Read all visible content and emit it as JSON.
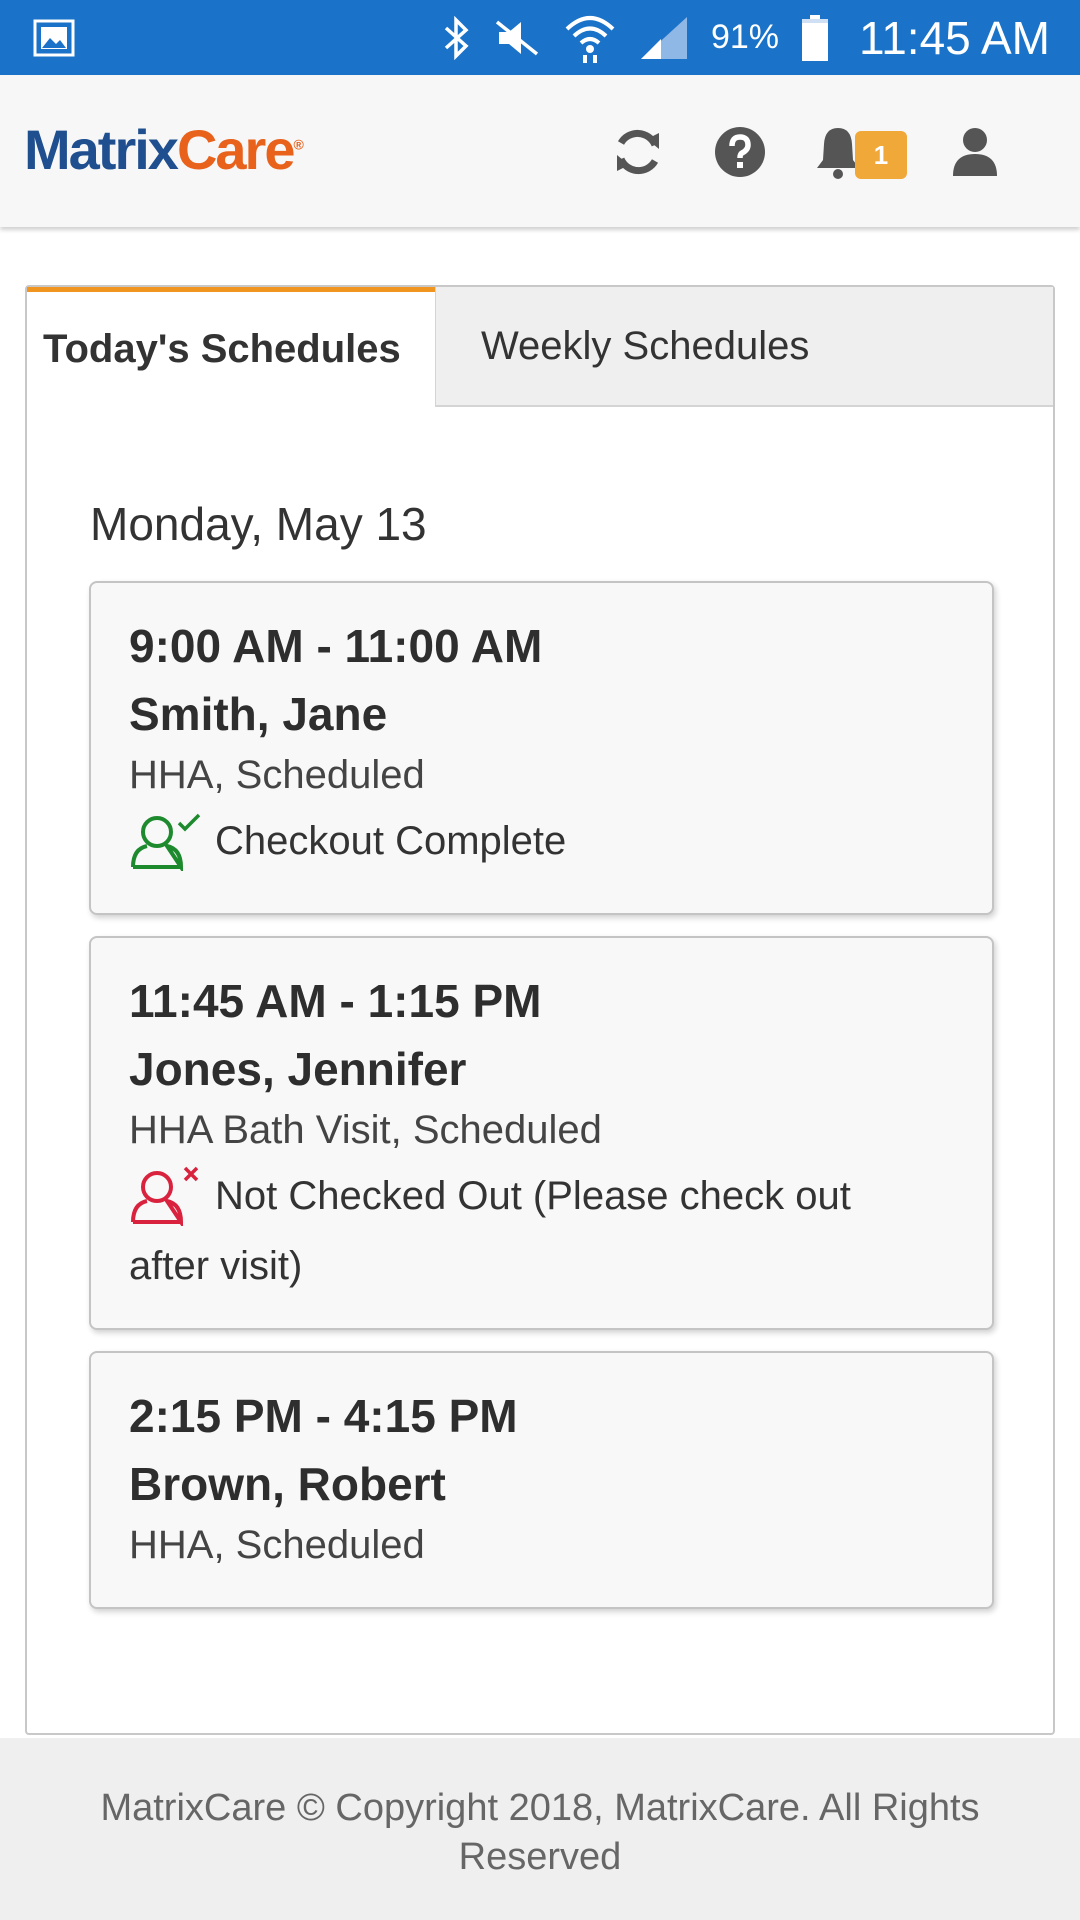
{
  "status_bar": {
    "battery": "91%",
    "time": "11:45 AM",
    "icons": [
      "gallery-icon",
      "bluetooth-icon",
      "mute-icon",
      "wifi-icon",
      "signal-icon",
      "battery-icon"
    ]
  },
  "header": {
    "logo_part1": "Matrix",
    "logo_part2": "Care",
    "logo_mark": "®",
    "notification_count": "1",
    "icons": [
      "refresh-icon",
      "help-icon",
      "bell-icon",
      "user-icon"
    ]
  },
  "tabs": [
    {
      "label": "Today's Schedules",
      "active": true
    },
    {
      "label": "Weekly Schedules",
      "active": false
    }
  ],
  "schedule": {
    "date": "Monday, May 13",
    "visits": [
      {
        "time": "9:00 AM - 11:00 AM",
        "client": "Smith, Jane",
        "service": "HHA, Scheduled",
        "status": "Checkout Complete",
        "status_icon": "checked-out-icon",
        "status_color": "#1e8a2e"
      },
      {
        "time": "11:45 AM - 1:15 PM",
        "client": "Jones, Jennifer",
        "service": "HHA Bath Visit, Scheduled",
        "status_line1": "Not Checked Out (Please check out",
        "status_line2": "after visit)",
        "status_icon": "not-checked-out-icon",
        "status_color": "#d9233e"
      },
      {
        "time": "2:15 PM - 4:15 PM",
        "client": "Brown, Robert",
        "service": "HHA, Scheduled"
      }
    ]
  },
  "footer": {
    "line1": "MatrixCare © Copyright 2018, MatrixCare. All Rights",
    "line2": "Reserved"
  },
  "colors": {
    "status_bar": "#1a73c8",
    "brand_blue": "#1f4f8f",
    "brand_orange": "#e8621c",
    "active_tab_accent": "#f0951f",
    "badge": "#f0a838"
  }
}
